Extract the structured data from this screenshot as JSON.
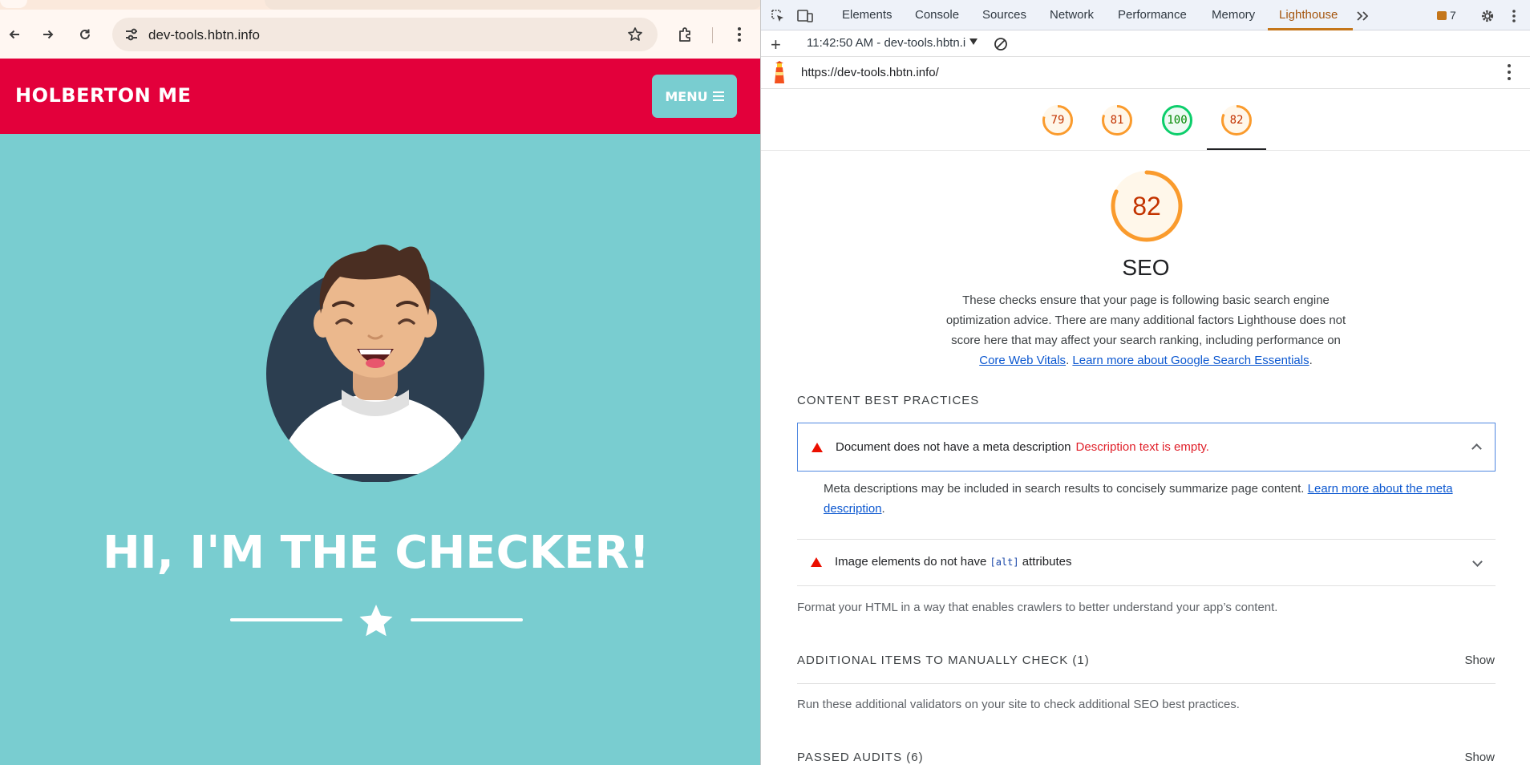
{
  "browser": {
    "url": "dev-tools.hbtn.info",
    "icons": [
      "back-icon",
      "forward-icon",
      "reload-icon",
      "site-settings-icon",
      "bookmark-star-icon",
      "extensions-icon",
      "kebab-menu-icon"
    ]
  },
  "site": {
    "logo": "HOLBERTON ME",
    "menu_label": "MENU",
    "hero_title": "HI, I'M THE CHECKER!",
    "colors": {
      "header": "#e3003b",
      "hero": "#79cdd0",
      "menu_button": "#79cdd0"
    }
  },
  "devtools": {
    "tabs": [
      {
        "label": "Elements"
      },
      {
        "label": "Console"
      },
      {
        "label": "Sources"
      },
      {
        "label": "Network"
      },
      {
        "label": "Performance"
      },
      {
        "label": "Memory"
      },
      {
        "label": "Lighthouse",
        "active": true
      }
    ],
    "issues_count": "7",
    "report_label": "11:42:50 AM - dev-tools.hbtn.i",
    "report_url": "https://dev-tools.hbtn.info/",
    "gauges": [
      {
        "score": "79",
        "color": "#fa9b2d",
        "bg": "#fff7ea",
        "text": "#c33300"
      },
      {
        "score": "81",
        "color": "#fa9b2d",
        "bg": "#fff7ea",
        "text": "#c33300"
      },
      {
        "score": "100",
        "color": "#0cce6b",
        "bg": "#eefaf3",
        "text": "#008800"
      },
      {
        "score": "82",
        "color": "#fa9b2d",
        "bg": "#fff7ea",
        "text": "#c33300",
        "selected": true
      }
    ],
    "seo": {
      "score": "82",
      "score_fraction": 0.82,
      "title": "SEO",
      "desc_text": "These checks ensure that your page is following basic search engine optimization advice. There are many additional factors Lighthouse does not score here that may affect your search ranking, including performance on ",
      "link1": "Core Web Vitals",
      "sep": ". ",
      "link2": "Learn more about Google Search Essentials",
      "end": "."
    },
    "groups": {
      "content_best_practices": "CONTENT BEST PRACTICES",
      "content_desc": "Format your HTML in a way that enables crawlers to better understand your app’s content.",
      "manual": "ADDITIONAL ITEMS TO MANUALLY CHECK",
      "manual_count": "(1)",
      "manual_desc": "Run these additional validators on your site to check additional SEO best practices.",
      "passed": "PASSED AUDITS",
      "passed_count": "(6)",
      "show_label": "Show"
    },
    "audits": {
      "meta_title": "Document does not have a meta description",
      "meta_error": "Description text is empty.",
      "meta_body": "Meta descriptions may be included in search results to concisely summarize page content. ",
      "meta_link": "Learn more about the meta description",
      "meta_end": ".",
      "img_title_before": "Image elements do not have ",
      "img_code": "[alt]",
      "img_title_after": " attributes"
    }
  }
}
